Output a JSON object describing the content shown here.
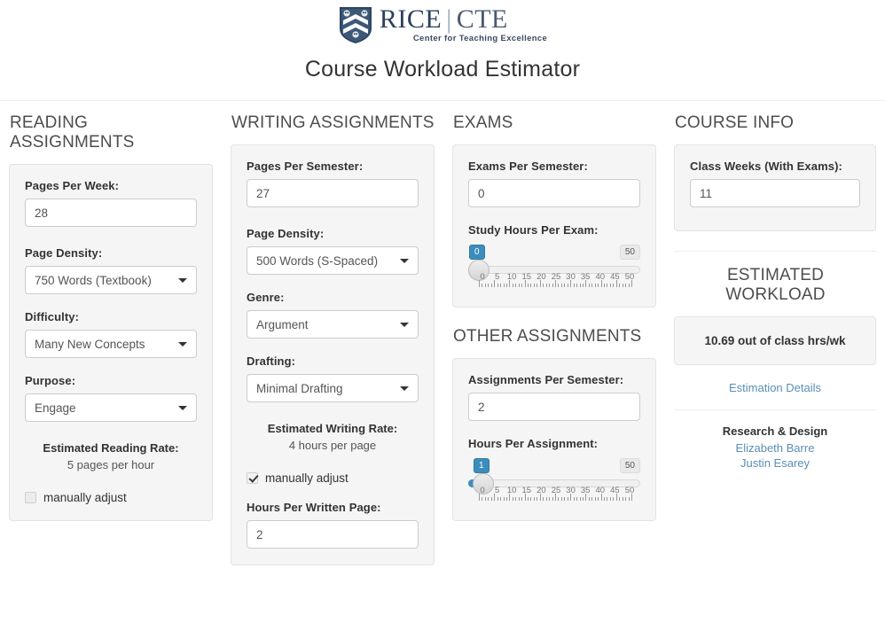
{
  "brand": {
    "logo_main_left": "RICE",
    "logo_divider": "|",
    "logo_main_right": "CTE",
    "logo_sub": "Center for Teaching Excellence",
    "shield_icon": "rice-shield-icon"
  },
  "page_title": "Course Workload Estimator",
  "accent_color": "#3c8dbc",
  "link_color": "#5a8fb5",
  "panel_bg": "#f5f5f5",
  "reading": {
    "heading": "READING ASSIGNMENTS",
    "pages_label": "Pages Per Week:",
    "pages_value": "28",
    "density_label": "Page Density:",
    "density_value": "750 Words (Textbook)",
    "difficulty_label": "Difficulty:",
    "difficulty_value": "Many New Concepts",
    "purpose_label": "Purpose:",
    "purpose_value": "Engage",
    "rate_title": "Estimated Reading Rate:",
    "rate_value": "5 pages per hour",
    "manual_label": "manually adjust",
    "manual_checked": false
  },
  "writing": {
    "heading": "WRITING ASSIGNMENTS",
    "pages_label": "Pages Per Semester:",
    "pages_value": "27",
    "density_label": "Page Density:",
    "density_value": "500 Words (S-Spaced)",
    "genre_label": "Genre:",
    "genre_value": "Argument",
    "drafting_label": "Drafting:",
    "drafting_value": "Minimal Drafting",
    "rate_title": "Estimated Writing Rate:",
    "rate_value": "4 hours per page",
    "manual_label": "manually adjust",
    "manual_checked": true,
    "hours_label": "Hours Per Written Page:",
    "hours_value": "2"
  },
  "exams": {
    "heading": "EXAMS",
    "count_label": "Exams Per Semester:",
    "count_value": "0",
    "slider_label": "Study Hours Per Exam:",
    "slider": {
      "value": "0",
      "max_badge": "50",
      "min": 0,
      "max": 50,
      "tick_labels": [
        "0",
        "5",
        "10",
        "15",
        "20",
        "25",
        "30",
        "35",
        "40",
        "45",
        "50"
      ]
    }
  },
  "other": {
    "heading": "OTHER ASSIGNMENTS",
    "count_label": "Assignments Per Semester:",
    "count_value": "2",
    "slider_label": "Hours Per Assignment:",
    "slider": {
      "value": "1",
      "max_badge": "50",
      "min": 0,
      "max": 50,
      "tick_labels": [
        "0",
        "5",
        "10",
        "15",
        "20",
        "25",
        "30",
        "35",
        "40",
        "45",
        "50"
      ]
    }
  },
  "course_info": {
    "heading": "COURSE INFO",
    "weeks_label": "Class Weeks (With Exams):",
    "weeks_value": "11"
  },
  "workload": {
    "heading": "ESTIMATED WORKLOAD",
    "result": "10.69 out of class hrs/wk",
    "details_link": "Estimation Details"
  },
  "credits": {
    "title": "Research & Design",
    "people": [
      "Elizabeth Barre",
      "Justin Esarey"
    ]
  }
}
